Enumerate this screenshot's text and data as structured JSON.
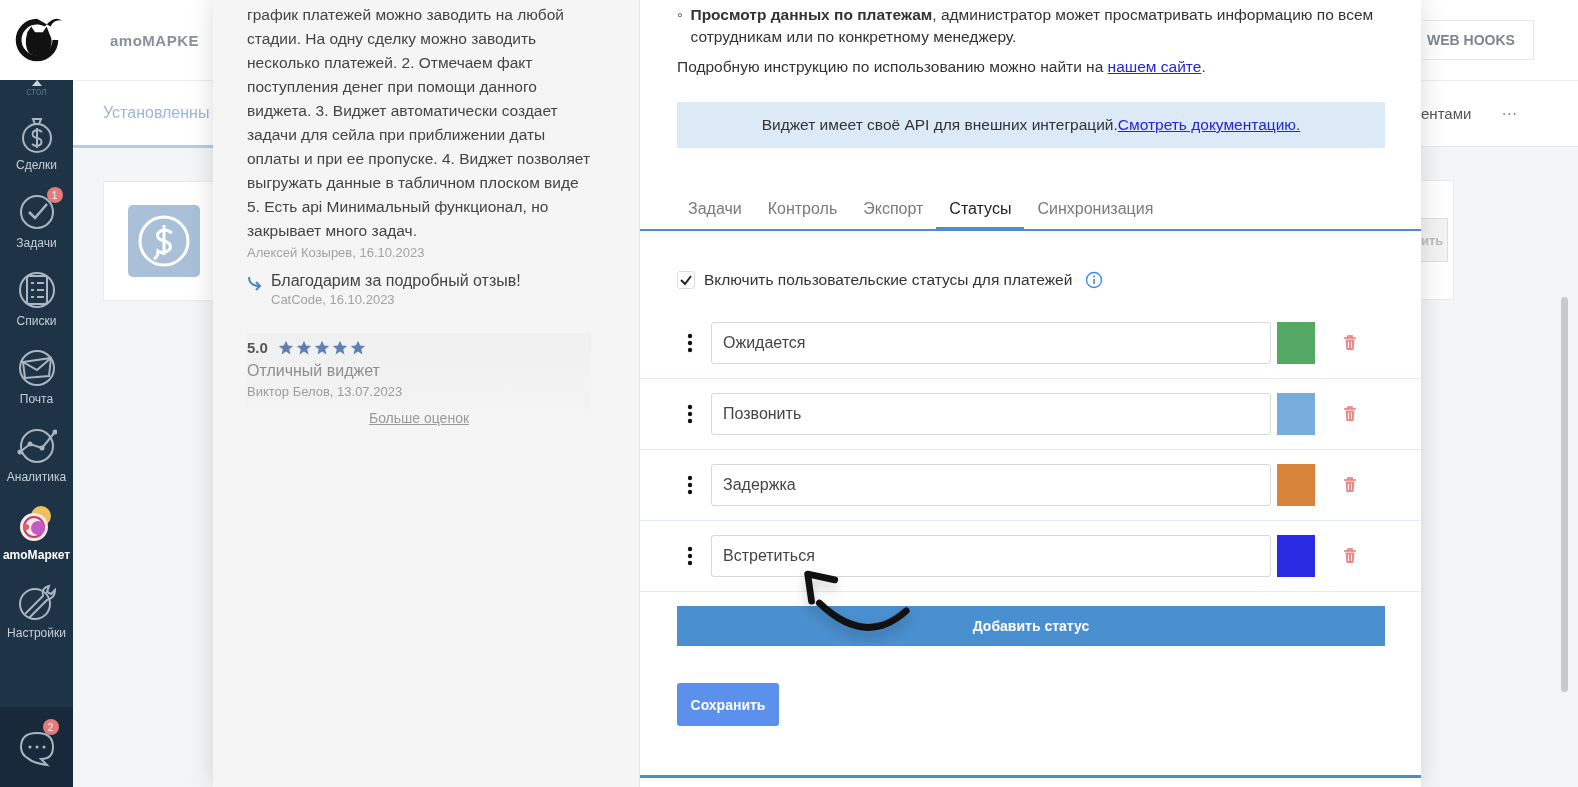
{
  "sidebar": {
    "scrolled_label": "стол",
    "items": [
      {
        "label": "Сделки",
        "selected": false
      },
      {
        "label": "Задачи",
        "selected": false,
        "badge": "1"
      },
      {
        "label": "Списки",
        "selected": false
      },
      {
        "label": "Почта",
        "selected": false
      },
      {
        "label": "Аналитика",
        "selected": false
      },
      {
        "label": "amoМаркет",
        "selected": true
      },
      {
        "label": "Настройки",
        "selected": false
      }
    ],
    "chat_badge": "2"
  },
  "background": {
    "title": "amoMAPKE",
    "tab": "Установленны",
    "webhooks_button": "WEB HOOKS",
    "tab_right": "ентами",
    "more": "···",
    "card_button": "ить"
  },
  "review_pane": {
    "review_text": "график платежей можно заводить на любой стадии. На одну сделку можно заводить несколько платежей. 2. Отмечаем факт поступления денег при помощи данного виджета. 3. Виджет автоматически создает задачи для сейла при приближении даты оплаты и при ее пропуске. 4. Виджет позволяет выгружать данные в табличном плоском виде 5. Есть api Минимальный функционал, но закрывает много задач.",
    "review_author": "Алексей Козырев, 16.10.2023",
    "reply_text": "Благодарим за подробный отзыв!",
    "reply_author": "CatCode, 16.10.2023",
    "rating": {
      "score": "5.0",
      "stars": 5,
      "title": "Отличный виджет",
      "author": "Виктор Белов, 13.07.2023"
    },
    "more_link": "Больше оценок"
  },
  "settings": {
    "bullet_marker": "◦",
    "bullet": "**Просмотр данных по платежам**, администратор может просматривать информацию по всем сотрудникам или по конкретному менеджеру.",
    "instruction": "Подробную инструкцию по использованию можно найти на ",
    "instruction_link": "нашем сайте",
    "instruction_end": ".",
    "api_note": "Виджет имеет своё API для внешних интеграций. ",
    "api_link": "Смотреть документацию.",
    "tabs": [
      {
        "label": "Задачи",
        "selected": false
      },
      {
        "label": "Контроль",
        "selected": false
      },
      {
        "label": "Экспорт",
        "selected": false
      },
      {
        "label": "Статусы",
        "selected": true
      },
      {
        "label": "Синхронизация",
        "selected": false
      }
    ],
    "enable_statuses": {
      "label": "Включить пользовательские статусы для платежей",
      "checked": true
    },
    "statuses": [
      {
        "name": "Ожидается",
        "color": "#55a863"
      },
      {
        "name": "Позвонить",
        "color": "#78acdc"
      },
      {
        "name": "Задержка",
        "color": "#d9843b"
      },
      {
        "name": "Встретиться",
        "color": "#2b2be3"
      }
    ],
    "add_button": "Добавить статус",
    "save_button": "Сохранить"
  }
}
